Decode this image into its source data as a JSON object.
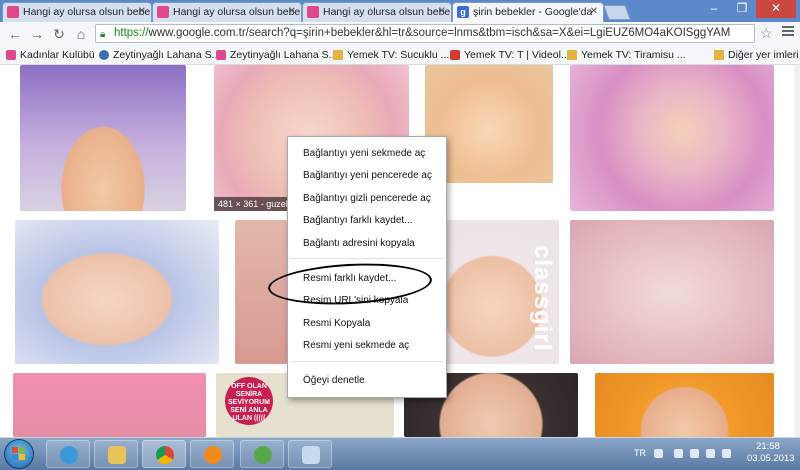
{
  "browser": {
    "tabs": [
      {
        "title": "Hangi ay olursa olsun bebe",
        "icon": "pink-favicon"
      },
      {
        "title": "Hangi ay olursa olsun bebe",
        "icon": "pink-favicon"
      },
      {
        "title": "Hangi ay olursa olsun bebe",
        "icon": "pink-favicon"
      },
      {
        "title": "şirin bebekler - Google'da",
        "icon": "google-favicon",
        "icon_letter": "g"
      }
    ],
    "url_scheme": "https://",
    "url_rest": "www.google.com.tr/search?q=şirin+bebekler&hl=tr&source=lnms&tbm=isch&sa=X&ei=LgiEUZ6MO4aKOISggYAM",
    "bookmarks": [
      {
        "label": "Kadınlar Kulübü",
        "icon": "pink"
      },
      {
        "label": "Zeytinyağlı Lahana S...",
        "icon": "wordpress"
      },
      {
        "label": "Zeytinyağlı Lahana S...",
        "icon": "pink"
      },
      {
        "label": "Yemek TV: Sucuklu ...",
        "icon": "doc"
      },
      {
        "label": "Yemek TV: T | Videol...",
        "icon": "youtube"
      },
      {
        "label": "Yemek TV: Tiramisu ...",
        "icon": "doc"
      },
      {
        "label": "Diğer yer imleri",
        "icon": "folder"
      }
    ]
  },
  "results": {
    "size_caption": "481 × 361 - guzell"
  },
  "context_menu": {
    "items": [
      "Bağlantıyı yeni sekmede aç",
      "Bağlantıyı yeni pencerede aç",
      "Bağlantıyı gizli pencerede aç",
      "Bağlantıyı farklı kaydet...",
      "Bağlantı adresini kopyala",
      "Resmi farklı kaydet...",
      "Resim URL'sini kopyala",
      "Resmi Kopyala",
      "Resmi yeni sekmede aç",
      "Öğeyi denetle"
    ]
  },
  "image_texts": {
    "rotated": "classgirl",
    "badge": "OFF OLAN SENİRA SEVİYORUM SENİ ANLA ULAN ((((("
  },
  "taskbar": {
    "language": "TR",
    "time": "21:58",
    "date": "03.05.2013"
  }
}
